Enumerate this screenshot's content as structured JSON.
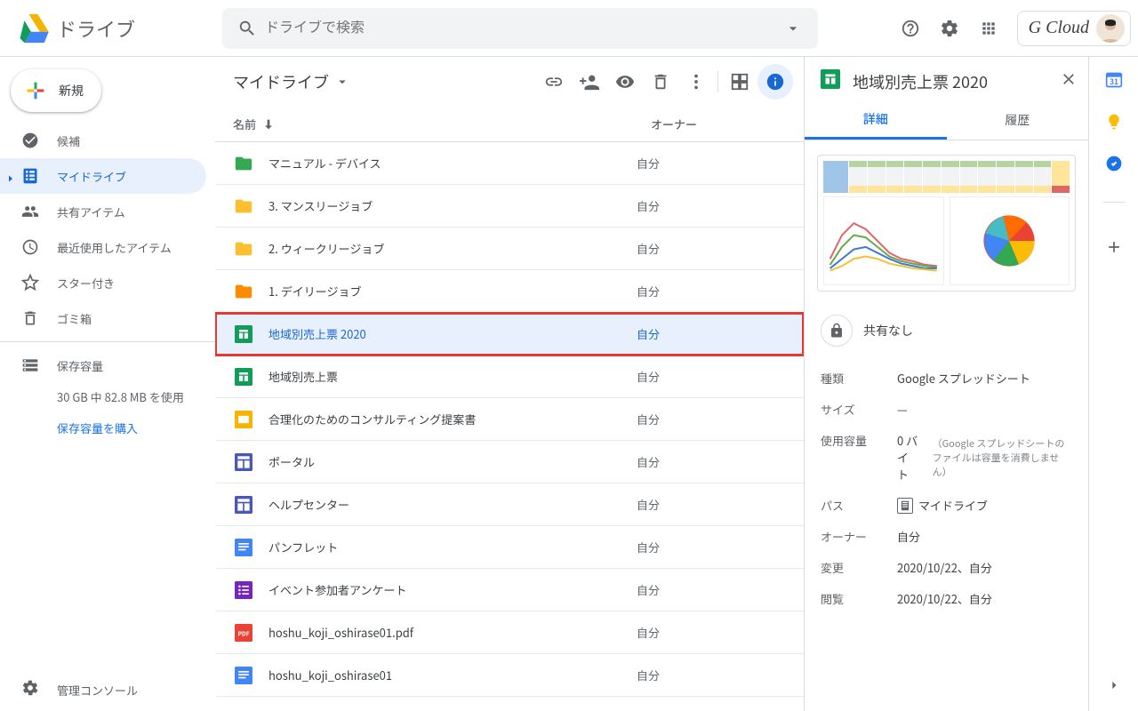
{
  "brand": "ドライブ",
  "search": {
    "placeholder": "ドライブで検索"
  },
  "account_label": "G Cloud",
  "new_button": "新規",
  "nav": [
    {
      "label": "候補"
    },
    {
      "label": "マイドライブ"
    },
    {
      "label": "共有アイテム"
    },
    {
      "label": "最近使用したアイテム"
    },
    {
      "label": "スター付き"
    },
    {
      "label": "ゴミ箱"
    }
  ],
  "storage": {
    "label": "保存容量",
    "text": "30 GB 中 82.8 MB を使用",
    "buy": "保存容量を購入"
  },
  "admin": "管理コンソール",
  "breadcrumb": "マイドライブ",
  "columns": {
    "name": "名前",
    "owner": "オーナー"
  },
  "files": [
    {
      "name": "マニュアル - デバイス",
      "owner": "自分",
      "icon": "folder-green"
    },
    {
      "name": "3. マンスリージョブ",
      "owner": "自分",
      "icon": "folder-yellow"
    },
    {
      "name": "2. ウィークリージョブ",
      "owner": "自分",
      "icon": "folder-yellow"
    },
    {
      "name": "1. デイリージョブ",
      "owner": "自分",
      "icon": "folder-orange"
    },
    {
      "name": "地域別売上票 2020",
      "owner": "自分",
      "icon": "sheets",
      "selected": true
    },
    {
      "name": "地域別売上票",
      "owner": "自分",
      "icon": "sheets"
    },
    {
      "name": "合理化のためのコンサルティング提案書",
      "owner": "自分",
      "icon": "slides"
    },
    {
      "name": "ポータル",
      "owner": "自分",
      "icon": "sites"
    },
    {
      "name": "ヘルプセンター",
      "owner": "自分",
      "icon": "sites"
    },
    {
      "name": "パンフレット",
      "owner": "自分",
      "icon": "docs"
    },
    {
      "name": "イベント参加者アンケート",
      "owner": "自分",
      "icon": "forms"
    },
    {
      "name": "hoshu_koji_oshirase01.pdf",
      "owner": "自分",
      "icon": "pdf"
    },
    {
      "name": "hoshu_koji_oshirase01",
      "owner": "自分",
      "icon": "docs"
    }
  ],
  "details": {
    "title": "地域別売上票 2020",
    "tabs": {
      "detail": "詳細",
      "history": "履歴"
    },
    "share": "共有なし",
    "props": {
      "type_k": "種類",
      "type_v": "Google スプレッドシート",
      "size_k": "サイズ",
      "size_v": "—",
      "usage_k": "使用容量",
      "usage_v": "0 バイト",
      "usage_note": "（Google スプレッドシートのファイルは容量を消費しません）",
      "path_k": "パス",
      "path_v": "マイドライブ",
      "owner_k": "オーナー",
      "owner_v": "自分",
      "mod_k": "変更",
      "mod_v": "2020/10/22、自分",
      "view_k": "閲覧",
      "view_v": "2020/10/22、自分"
    }
  }
}
